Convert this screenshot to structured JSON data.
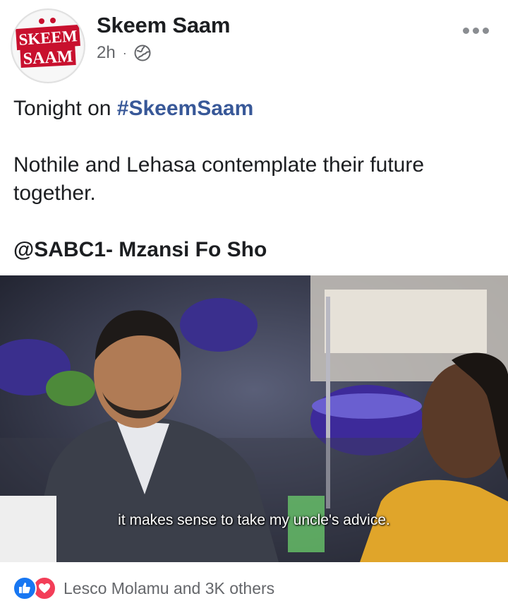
{
  "header": {
    "page_name": "Skeem Saam",
    "avatar_logo_text": "SKEEM SAAM",
    "time": "2h",
    "separator": "·",
    "audience_icon": "globe-icon",
    "more_icon": "more-horizontal-icon"
  },
  "post": {
    "line1_prefix": "Tonight on ",
    "hashtag": "#SkeemSaam",
    "line2": "Nothile and Lehasa contemplate their future together.",
    "line3": "@SABC1- Mzansi Fo Sho"
  },
  "media": {
    "subtitle": "it makes sense to take my uncle's advice."
  },
  "reactions": {
    "icons": [
      "like-icon",
      "love-icon"
    ],
    "colors": {
      "like": "#1877f2",
      "love": "#f33e58"
    },
    "summary": "Lesco Molamu and 3K others"
  },
  "colors": {
    "hashtag": "#385898",
    "meta": "#65676b"
  }
}
